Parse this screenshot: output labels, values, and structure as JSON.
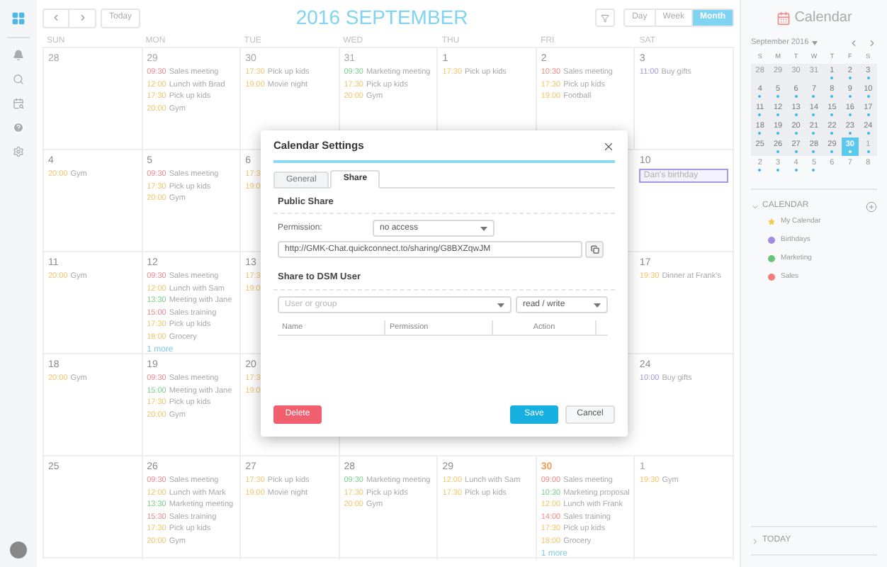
{
  "toolbar": {
    "today": "Today",
    "title": "2016 SEPTEMBER",
    "views": [
      {
        "label": "Day",
        "selected": false
      },
      {
        "label": "Week",
        "selected": false
      },
      {
        "label": "Month",
        "selected": true
      }
    ]
  },
  "calendar": {
    "weekdays": [
      "SUN",
      "MON",
      "TUE",
      "WED",
      "THU",
      "FRI",
      "SAT"
    ],
    "weeks": [
      {
        "days": [
          {
            "date": "28",
            "muted": true,
            "today": false
          },
          {
            "date": "29",
            "muted": true,
            "today": false,
            "events": [
              {
                "kind": "timed",
                "time": "09:30",
                "title": "Sales meeting",
                "color": "#f08a8a"
              },
              {
                "kind": "timed",
                "time": "12:00",
                "title": "Lunch with Brad",
                "color": "#f2c46d"
              },
              {
                "kind": "timed",
                "time": "17:30",
                "title": "Pick up kids",
                "color": "#f2c46d"
              },
              {
                "kind": "timed",
                "time": "20:00",
                "title": "Gym",
                "color": "#f2c46d"
              }
            ]
          },
          {
            "date": "30",
            "muted": true,
            "today": false,
            "events": [
              {
                "kind": "timed",
                "time": "17:30",
                "title": "Pick up kids",
                "color": "#f2c46d"
              },
              {
                "kind": "timed",
                "time": "19:00",
                "title": "Movie night",
                "color": "#f2c46d"
              }
            ]
          },
          {
            "date": "31",
            "muted": true,
            "today": false,
            "events": [
              {
                "kind": "timed",
                "time": "09:30",
                "title": "Marketing meeting",
                "color": "#7ccf8c"
              },
              {
                "kind": "timed",
                "time": "17:30",
                "title": "Pick up kids",
                "color": "#f2c46d"
              },
              {
                "kind": "timed",
                "time": "20:00",
                "title": "Gym",
                "color": "#f2c46d"
              }
            ]
          },
          {
            "date": "1",
            "muted": false,
            "today": false,
            "events": [
              {
                "kind": "timed",
                "time": "17:30",
                "title": "Pick up kids",
                "color": "#f2c46d"
              }
            ]
          },
          {
            "date": "2",
            "muted": false,
            "today": false,
            "events": [
              {
                "kind": "timed",
                "time": "10:30",
                "title": "Sales meeting",
                "color": "#f08a8a"
              },
              {
                "kind": "timed",
                "time": "17:30",
                "title": "Pick up kids",
                "color": "#f2c46d"
              },
              {
                "kind": "timed",
                "time": "19:00",
                "title": "Football",
                "color": "#f2c46d"
              }
            ]
          },
          {
            "date": "3",
            "muted": false,
            "today": false,
            "events": [
              {
                "kind": "timed",
                "time": "11:00",
                "title": "Buy gifts",
                "color": "#a896e6"
              }
            ]
          }
        ]
      },
      {
        "days": [
          {
            "date": "4",
            "muted": false,
            "today": false,
            "events": [
              {
                "kind": "timed",
                "time": "20:00",
                "title": "Gym",
                "color": "#f2c46d"
              }
            ]
          },
          {
            "date": "5",
            "muted": false,
            "today": false,
            "events": [
              {
                "kind": "timed",
                "time": "09:30",
                "title": "Sales meeting",
                "color": "#f08a8a"
              },
              {
                "kind": "timed",
                "time": "17:30",
                "title": "Pick up kids",
                "color": "#f2c46d"
              },
              {
                "kind": "timed",
                "time": "20:00",
                "title": "Gym",
                "color": "#f2c46d"
              }
            ]
          },
          {
            "date": "6",
            "muted": false,
            "today": false,
            "events": [
              {
                "kind": "timed",
                "time": "17:3",
                "color": "#f2c46d"
              },
              {
                "kind": "timed",
                "time": "19:0",
                "color": "#f2c46d"
              }
            ]
          },
          {
            "date": "10",
            "muted": false,
            "today": false,
            "events": [
              {
                "kind": "allday",
                "title": "Dan's birthday",
                "color": "#a896e6"
              }
            ]
          }
        ]
      },
      {
        "days": [
          {
            "date": "11",
            "muted": false,
            "today": false,
            "events": [
              {
                "kind": "timed",
                "time": "20:00",
                "title": "Gym",
                "color": "#f2c46d"
              }
            ]
          },
          {
            "date": "12",
            "muted": false,
            "today": false,
            "more": "1 more",
            "events": [
              {
                "kind": "timed",
                "time": "09:30",
                "title": "Sales meeting",
                "color": "#f08a8a"
              },
              {
                "kind": "timed",
                "time": "12:00",
                "title": "Lunch with Sam",
                "color": "#f2c46d"
              },
              {
                "kind": "timed",
                "time": "13:30",
                "title": "Meeting with Jane",
                "color": "#7ccf8c"
              },
              {
                "kind": "timed",
                "time": "15:00",
                "title": "Sales training",
                "color": "#f08a8a"
              },
              {
                "kind": "timed",
                "time": "17:30",
                "title": "Pick up kids",
                "color": "#f2c46d"
              },
              {
                "kind": "timed",
                "time": "18:00",
                "title": "Grocery",
                "color": "#f2c46d"
              }
            ]
          },
          {
            "date": "13",
            "muted": false,
            "today": false,
            "events": [
              {
                "kind": "timed",
                "time": "17:3",
                "color": "#f2c46d"
              },
              {
                "kind": "timed",
                "time": "19:0",
                "color": "#f2c46d"
              }
            ]
          },
          {
            "date": "17",
            "muted": false,
            "today": false,
            "events": [
              {
                "kind": "timed",
                "time": "19:30",
                "title": "Dinner at Frank's",
                "color": "#f2c46d"
              }
            ]
          }
        ]
      },
      {
        "days": [
          {
            "date": "18",
            "muted": false,
            "today": false,
            "events": [
              {
                "kind": "timed",
                "time": "20:00",
                "title": "Gym",
                "color": "#f2c46d"
              }
            ]
          },
          {
            "date": "19",
            "muted": false,
            "today": false,
            "events": [
              {
                "kind": "timed",
                "time": "09:30",
                "title": "Sales meeting",
                "color": "#f08a8a"
              },
              {
                "kind": "timed",
                "time": "15:00",
                "title": "Meeting with Jane",
                "color": "#7ccf8c"
              },
              {
                "kind": "timed",
                "time": "17:30",
                "title": "Pick up kids",
                "color": "#f2c46d"
              },
              {
                "kind": "timed",
                "time": "20:00",
                "title": "Gym",
                "color": "#f2c46d"
              }
            ]
          },
          {
            "date": "20",
            "muted": false,
            "today": false,
            "events": [
              {
                "kind": "timed",
                "time": "17:3",
                "color": "#f2c46d"
              },
              {
                "kind": "timed",
                "time": "19:0",
                "color": "#f2c46d"
              }
            ]
          },
          {
            "date": "24",
            "muted": false,
            "today": false,
            "events": [
              {
                "kind": "timed",
                "time": "10:00",
                "title": "Buy gifts",
                "color": "#a896e6"
              }
            ]
          }
        ]
      },
      {
        "days": [
          {
            "date": "25",
            "muted": false,
            "today": false
          },
          {
            "date": "26",
            "muted": false,
            "today": false,
            "events": [
              {
                "kind": "timed",
                "time": "09:30",
                "title": "Sales meeting",
                "color": "#f08a8a"
              },
              {
                "kind": "timed",
                "time": "12:00",
                "title": "Lunch with Mark",
                "color": "#f2c46d"
              },
              {
                "kind": "timed",
                "time": "13:30",
                "title": "Marketing meeting",
                "color": "#7ccf8c"
              },
              {
                "kind": "timed",
                "time": "15:30",
                "title": "Sales training",
                "color": "#f08a8a"
              },
              {
                "kind": "timed",
                "time": "17:30",
                "title": "Pick up kids",
                "color": "#f2c46d"
              },
              {
                "kind": "timed",
                "time": "20:00",
                "title": "Gym",
                "color": "#f2c46d"
              }
            ]
          },
          {
            "date": "27",
            "muted": false,
            "today": false,
            "events": [
              {
                "kind": "timed",
                "time": "17:30",
                "title": "Pick up kids",
                "color": "#f2c46d"
              },
              {
                "kind": "timed",
                "time": "19:00",
                "title": "Movie night",
                "color": "#f2c46d"
              }
            ]
          },
          {
            "date": "28",
            "muted": false,
            "today": false,
            "events": [
              {
                "kind": "timed",
                "time": "09:30",
                "title": "Marketing meeting",
                "color": "#7ccf8c"
              },
              {
                "kind": "timed",
                "time": "17:30",
                "title": "Pick up kids",
                "color": "#f2c46d"
              },
              {
                "kind": "timed",
                "time": "20:00",
                "title": "Gym",
                "color": "#f2c46d"
              }
            ]
          },
          {
            "date": "29",
            "muted": false,
            "today": false,
            "events": [
              {
                "kind": "timed",
                "time": "12:00",
                "title": "Lunch with Sam",
                "color": "#f2c46d"
              },
              {
                "kind": "timed",
                "time": "17:30",
                "title": "Pick up kids",
                "color": "#f2c46d"
              }
            ]
          },
          {
            "date": "30",
            "muted": false,
            "today": true,
            "more": "1 more",
            "events": [
              {
                "kind": "timed",
                "time": "09:00",
                "title": "Sales meeting",
                "color": "#f08a8a"
              },
              {
                "kind": "timed",
                "time": "10:30",
                "title": "Marketing proposal",
                "color": "#7ccf8c"
              },
              {
                "kind": "timed",
                "time": "12:00",
                "title": "Lunch with Frank",
                "color": "#f2c46d"
              },
              {
                "kind": "timed",
                "time": "14:00",
                "title": "Sales training",
                "color": "#f08a8a"
              },
              {
                "kind": "timed",
                "time": "17:30",
                "title": "Pick up kids",
                "color": "#f2c46d"
              },
              {
                "kind": "timed",
                "time": "18:00",
                "title": "Grocery",
                "color": "#f2c46d"
              }
            ]
          },
          {
            "date": "1",
            "muted": true,
            "today": false,
            "events": [
              {
                "kind": "timed",
                "time": "19:30",
                "title": "Gym",
                "color": "#f2c46d"
              }
            ]
          }
        ]
      }
    ]
  },
  "dialog": {
    "title": "Calendar Settings",
    "tabs": [
      {
        "label": "General",
        "selected": false
      },
      {
        "label": "Share",
        "selected": true
      }
    ],
    "public_share": {
      "heading": "Public Share",
      "permission_label": "Permission:",
      "permission_value": "no access",
      "link": "http://GMK-Chat.quickconnect.to/sharing/G8BXZqwJM"
    },
    "dsm_share": {
      "heading": "Share to DSM User",
      "user_placeholder": "User or group",
      "permission_value": "read / write",
      "columns": [
        "Name",
        "Permission",
        "Action"
      ]
    },
    "buttons": {
      "delete": "Delete",
      "save": "Save",
      "cancel": "Cancel"
    }
  },
  "sidebar": {
    "title": "Calendar",
    "mini_calendar": {
      "title": "September 2016",
      "weekdays": [
        "S",
        "M",
        "T",
        "W",
        "T",
        "F",
        "S"
      ],
      "weeks": [
        {
          "in_view": true,
          "days": [
            {
              "label": "28",
              "muted": true,
              "dot": false,
              "selected": false
            },
            {
              "label": "29",
              "muted": true,
              "dot": false,
              "selected": false
            },
            {
              "label": "30",
              "muted": true,
              "dot": false,
              "selected": false
            },
            {
              "label": "31",
              "muted": true,
              "dot": false,
              "selected": false
            },
            {
              "label": "1",
              "muted": false,
              "dot": true,
              "selected": false
            },
            {
              "label": "2",
              "muted": false,
              "dot": true,
              "selected": false
            },
            {
              "label": "3",
              "muted": false,
              "dot": true,
              "selected": false
            }
          ]
        },
        {
          "in_view": true,
          "days": [
            {
              "label": "4",
              "muted": false,
              "dot": true,
              "selected": false
            },
            {
              "label": "5",
              "muted": false,
              "dot": true,
              "selected": false
            },
            {
              "label": "6",
              "muted": false,
              "dot": true,
              "selected": false
            },
            {
              "label": "7",
              "muted": false,
              "dot": true,
              "selected": false
            },
            {
              "label": "8",
              "muted": false,
              "dot": true,
              "selected": false
            },
            {
              "label": "9",
              "muted": false,
              "dot": true,
              "selected": false
            },
            {
              "label": "10",
              "muted": false,
              "dot": true,
              "selected": false
            }
          ]
        },
        {
          "in_view": true,
          "days": [
            {
              "label": "11",
              "muted": false,
              "dot": true,
              "selected": false
            },
            {
              "label": "12",
              "muted": false,
              "dot": true,
              "selected": false
            },
            {
              "label": "13",
              "muted": false,
              "dot": true,
              "selected": false
            },
            {
              "label": "14",
              "muted": false,
              "dot": true,
              "selected": false
            },
            {
              "label": "15",
              "muted": false,
              "dot": true,
              "selected": false
            },
            {
              "label": "16",
              "muted": false,
              "dot": true,
              "selected": false
            },
            {
              "label": "17",
              "muted": false,
              "dot": true,
              "selected": false
            }
          ]
        },
        {
          "in_view": true,
          "days": [
            {
              "label": "18",
              "muted": false,
              "dot": true,
              "selected": false
            },
            {
              "label": "19",
              "muted": false,
              "dot": true,
              "selected": false
            },
            {
              "label": "20",
              "muted": false,
              "dot": true,
              "selected": false
            },
            {
              "label": "21",
              "muted": false,
              "dot": true,
              "selected": false
            },
            {
              "label": "22",
              "muted": false,
              "dot": true,
              "selected": false
            },
            {
              "label": "23",
              "muted": false,
              "dot": true,
              "selected": false
            },
            {
              "label": "24",
              "muted": false,
              "dot": true,
              "selected": false
            }
          ]
        },
        {
          "in_view": true,
          "days": [
            {
              "label": "25",
              "muted": false,
              "dot": false,
              "selected": false
            },
            {
              "label": "26",
              "muted": false,
              "dot": true,
              "selected": false
            },
            {
              "label": "27",
              "muted": false,
              "dot": true,
              "selected": false
            },
            {
              "label": "28",
              "muted": false,
              "dot": true,
              "selected": false
            },
            {
              "label": "29",
              "muted": false,
              "dot": true,
              "selected": false
            },
            {
              "label": "30",
              "muted": false,
              "dot": true,
              "selected": true
            },
            {
              "label": "1",
              "muted": true,
              "dot": true,
              "selected": false
            }
          ]
        },
        {
          "in_view": false,
          "days": [
            {
              "label": "2",
              "muted": true,
              "dot": true,
              "selected": false
            },
            {
              "label": "3",
              "muted": true,
              "dot": true,
              "selected": false
            },
            {
              "label": "4",
              "muted": true,
              "dot": true,
              "selected": false
            },
            {
              "label": "5",
              "muted": true,
              "dot": true,
              "selected": false
            },
            {
              "label": "6",
              "muted": true,
              "dot": false,
              "selected": false
            },
            {
              "label": "7",
              "muted": true,
              "dot": false,
              "selected": false
            },
            {
              "label": "8",
              "muted": true,
              "dot": false,
              "selected": false
            }
          ]
        }
      ]
    },
    "calendars": {
      "heading": "CALENDAR",
      "expanded": true,
      "items": [
        {
          "kind": "star",
          "label": "My Calendar",
          "color": "#f2c94c"
        },
        {
          "kind": "dot",
          "label": "Birthdays",
          "color": "#a08ce0"
        },
        {
          "kind": "dot",
          "label": "Marketing",
          "color": "#6cc47c"
        },
        {
          "kind": "dot",
          "label": "Sales",
          "color": "#f07c7c"
        }
      ]
    },
    "today_section": {
      "heading": "TODAY",
      "expanded": false
    }
  }
}
